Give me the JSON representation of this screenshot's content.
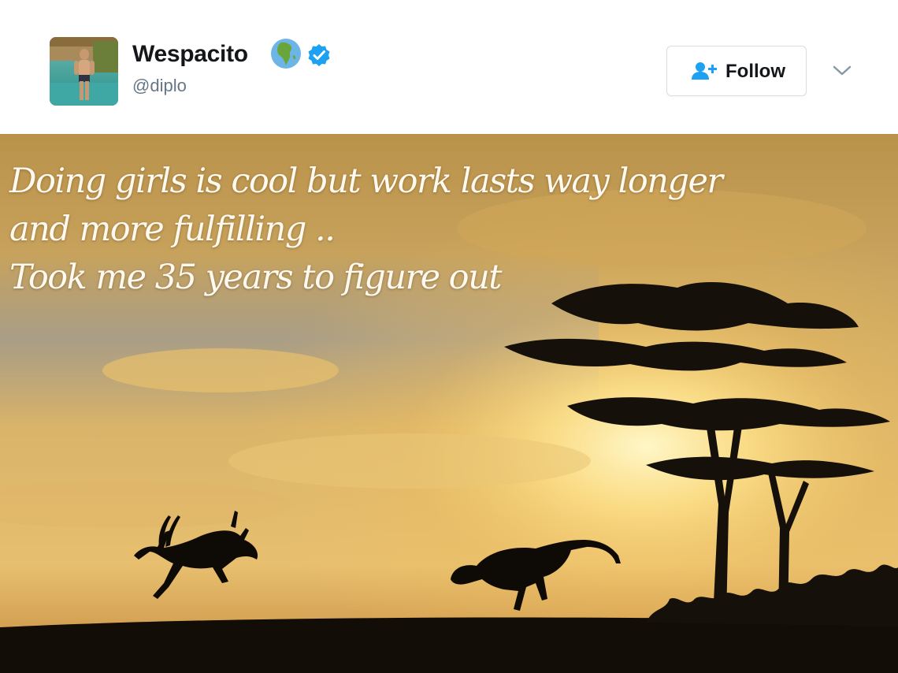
{
  "user": {
    "display_name": "Wespacito",
    "handle": "@diplo"
  },
  "follow_button": {
    "label": "Follow"
  },
  "icons": {
    "badge_emoji": "globe-africa-icon",
    "verified": "verified-badge-icon",
    "follow": "add-user-icon",
    "menu": "chevron-down-icon"
  },
  "media": {
    "caption_lines": [
      "Doing girls is cool but work lasts way longer",
      "and more fulfilling ..",
      "Took me 35 years to figure out"
    ]
  },
  "colors": {
    "verified_blue": "#1da1f2",
    "text_primary": "#14171a",
    "text_secondary": "#657786"
  }
}
